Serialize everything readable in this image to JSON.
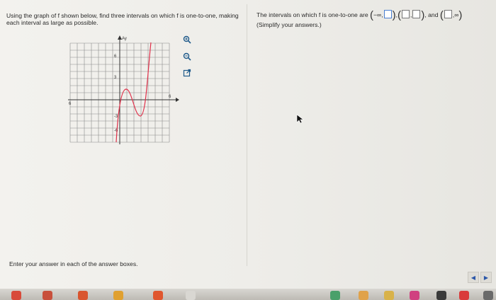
{
  "question": {
    "text": "Using the graph of f shown below, find three intervals on which f is one-to-one, making each interval as large as possible."
  },
  "answer": {
    "prefix": "The intervals on which f is one-to-one are",
    "neg_inf": "−∞,",
    "comma": ",",
    "and": "and",
    "pos_inf": "∞",
    "hint": "(Simplify your answers.)"
  },
  "graph": {
    "y_axis_label": "Ay",
    "tick_labels": [
      "6",
      "3",
      "6",
      "-3",
      "-6",
      "6"
    ]
  },
  "tools": [
    "zoom-in-icon",
    "zoom-out-icon",
    "external-link-icon"
  ],
  "footer": {
    "instruction": "Enter your answer in each of the answer boxes."
  },
  "nav": {
    "prev": "◀",
    "next": "▶"
  },
  "colors": {
    "curve": "#e0304a",
    "axis": "#333333",
    "box_active": "#4a7fd0",
    "link": "#1f5a8a"
  }
}
